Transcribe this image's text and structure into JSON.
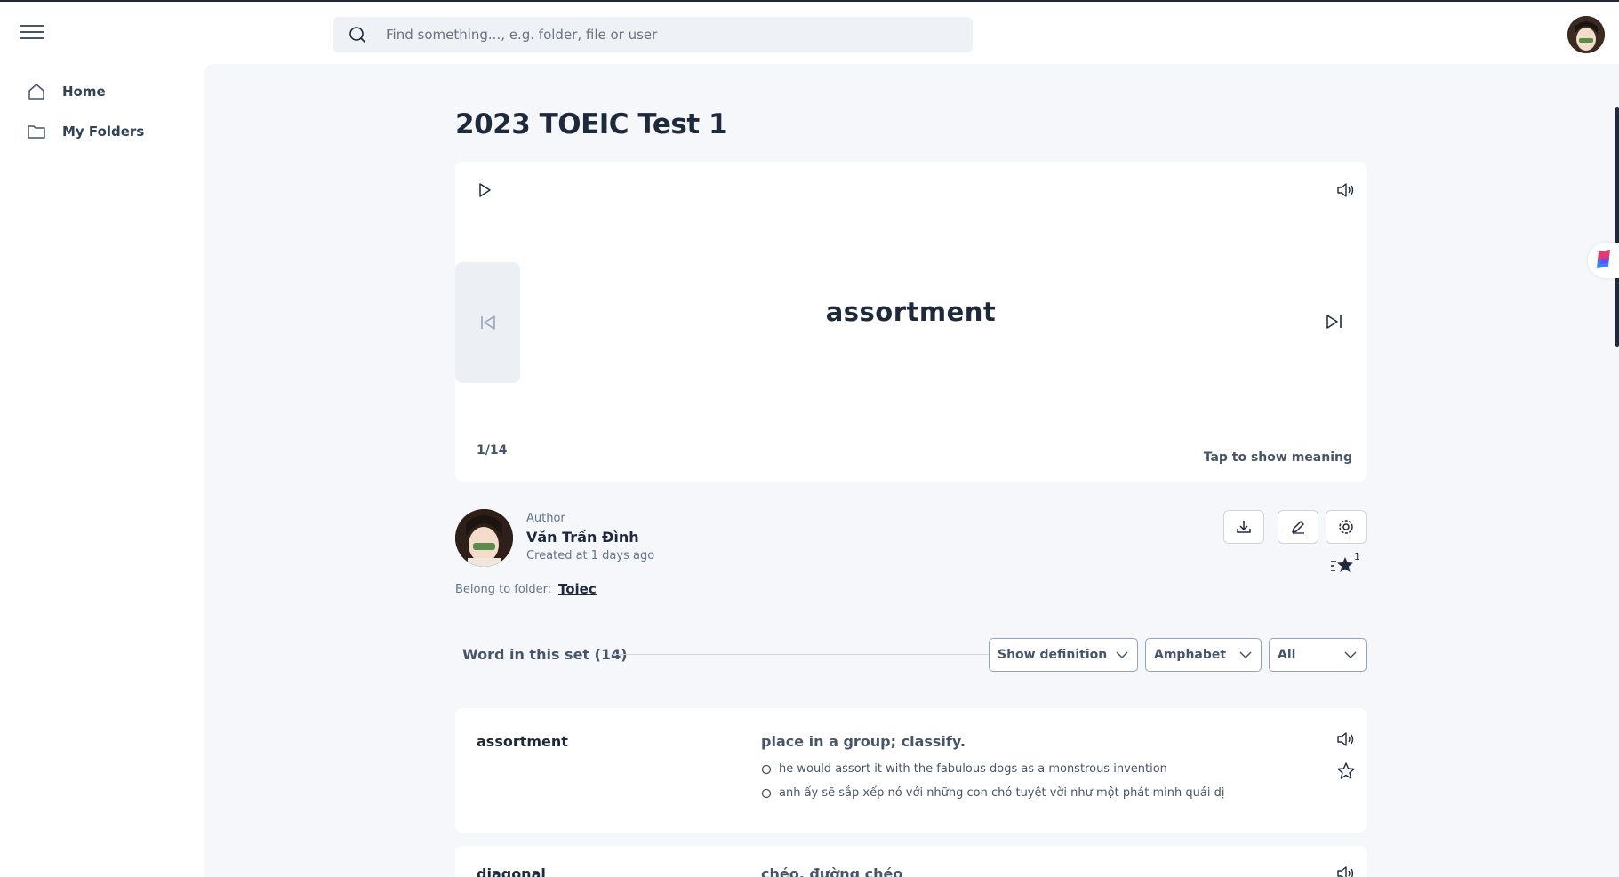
{
  "search": {
    "placeholder": "Find something..., e.g. folder, file or user"
  },
  "sidebar": {
    "items": [
      {
        "label": "Home",
        "icon": "home-icon"
      },
      {
        "label": "My Folders",
        "icon": "folder-icon"
      }
    ]
  },
  "page": {
    "title": "2023 TOEIC Test 1"
  },
  "flashcard": {
    "term": "assortment",
    "counter": "1/14",
    "tap_hint": "Tap to show meaning",
    "icons": [
      "play-icon",
      "speaker-icon",
      "previous-icon",
      "next-icon"
    ]
  },
  "author": {
    "label": "Author",
    "name": "Văn Trần Đình",
    "created": "Created at 1 days ago",
    "belong_label": "Belong to folder:",
    "folder": "Toiec"
  },
  "actions": {
    "icons": [
      "download-icon",
      "edit-icon",
      "settings-icon",
      "starred-list-icon"
    ],
    "star_count": "1"
  },
  "word_list": {
    "heading": "Word in this set (14)",
    "filters": [
      "Show definition",
      "Amphabet",
      "All"
    ],
    "items": [
      {
        "term": "assortment",
        "definition": "place in a group; classify.",
        "examples": [
          "he would assort it with the fabulous dogs as a monstrous invention",
          "anh ấy sẽ sắp xếp nó với những con chó tuyệt vời như một phát minh quái dị"
        ]
      },
      {
        "term": "diagonal",
        "definition": "chéo, đường chéo",
        "examples": []
      }
    ]
  },
  "colors": {
    "main_bg": "#f5f7fb",
    "card_bg": "#ffffff",
    "text_dark": "#1e293b",
    "text_muted": "#475569"
  }
}
